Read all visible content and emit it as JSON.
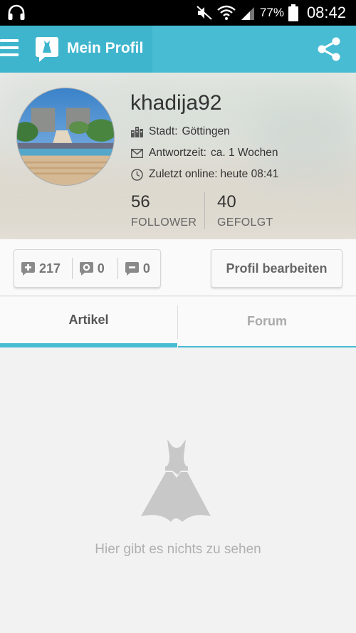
{
  "status_bar": {
    "battery": "77%",
    "time": "08:42",
    "icons": [
      "headphones-icon",
      "mute-icon",
      "wifi-icon",
      "signal-icon",
      "battery-icon"
    ]
  },
  "app_bar": {
    "title": "Mein Profil",
    "color": "#47bcd3",
    "icons": [
      "menu-icon",
      "app-logo-icon",
      "share-icon"
    ]
  },
  "profile": {
    "username": "khadija92",
    "city_label": "Stadt:",
    "city_value": "Göttingen",
    "answer_label": "Antwortzeit:",
    "answer_value": "ca. 1 Wochen",
    "online_label": "Zuletzt online:",
    "online_value": "heute 08:41",
    "follower_count": "56",
    "follower_label": "FOLLOWER",
    "following_count": "40",
    "following_label": "GEFOLGT"
  },
  "counters": {
    "plus": "217",
    "comments": "0",
    "minus": "0"
  },
  "edit_button": "Profil bearbeiten",
  "tabs": [
    {
      "label": "Artikel",
      "active": true
    },
    {
      "label": "Forum",
      "active": false
    }
  ],
  "empty_state": {
    "icon": "dress-icon",
    "text": "Hier gibt es nichts zu sehen"
  }
}
